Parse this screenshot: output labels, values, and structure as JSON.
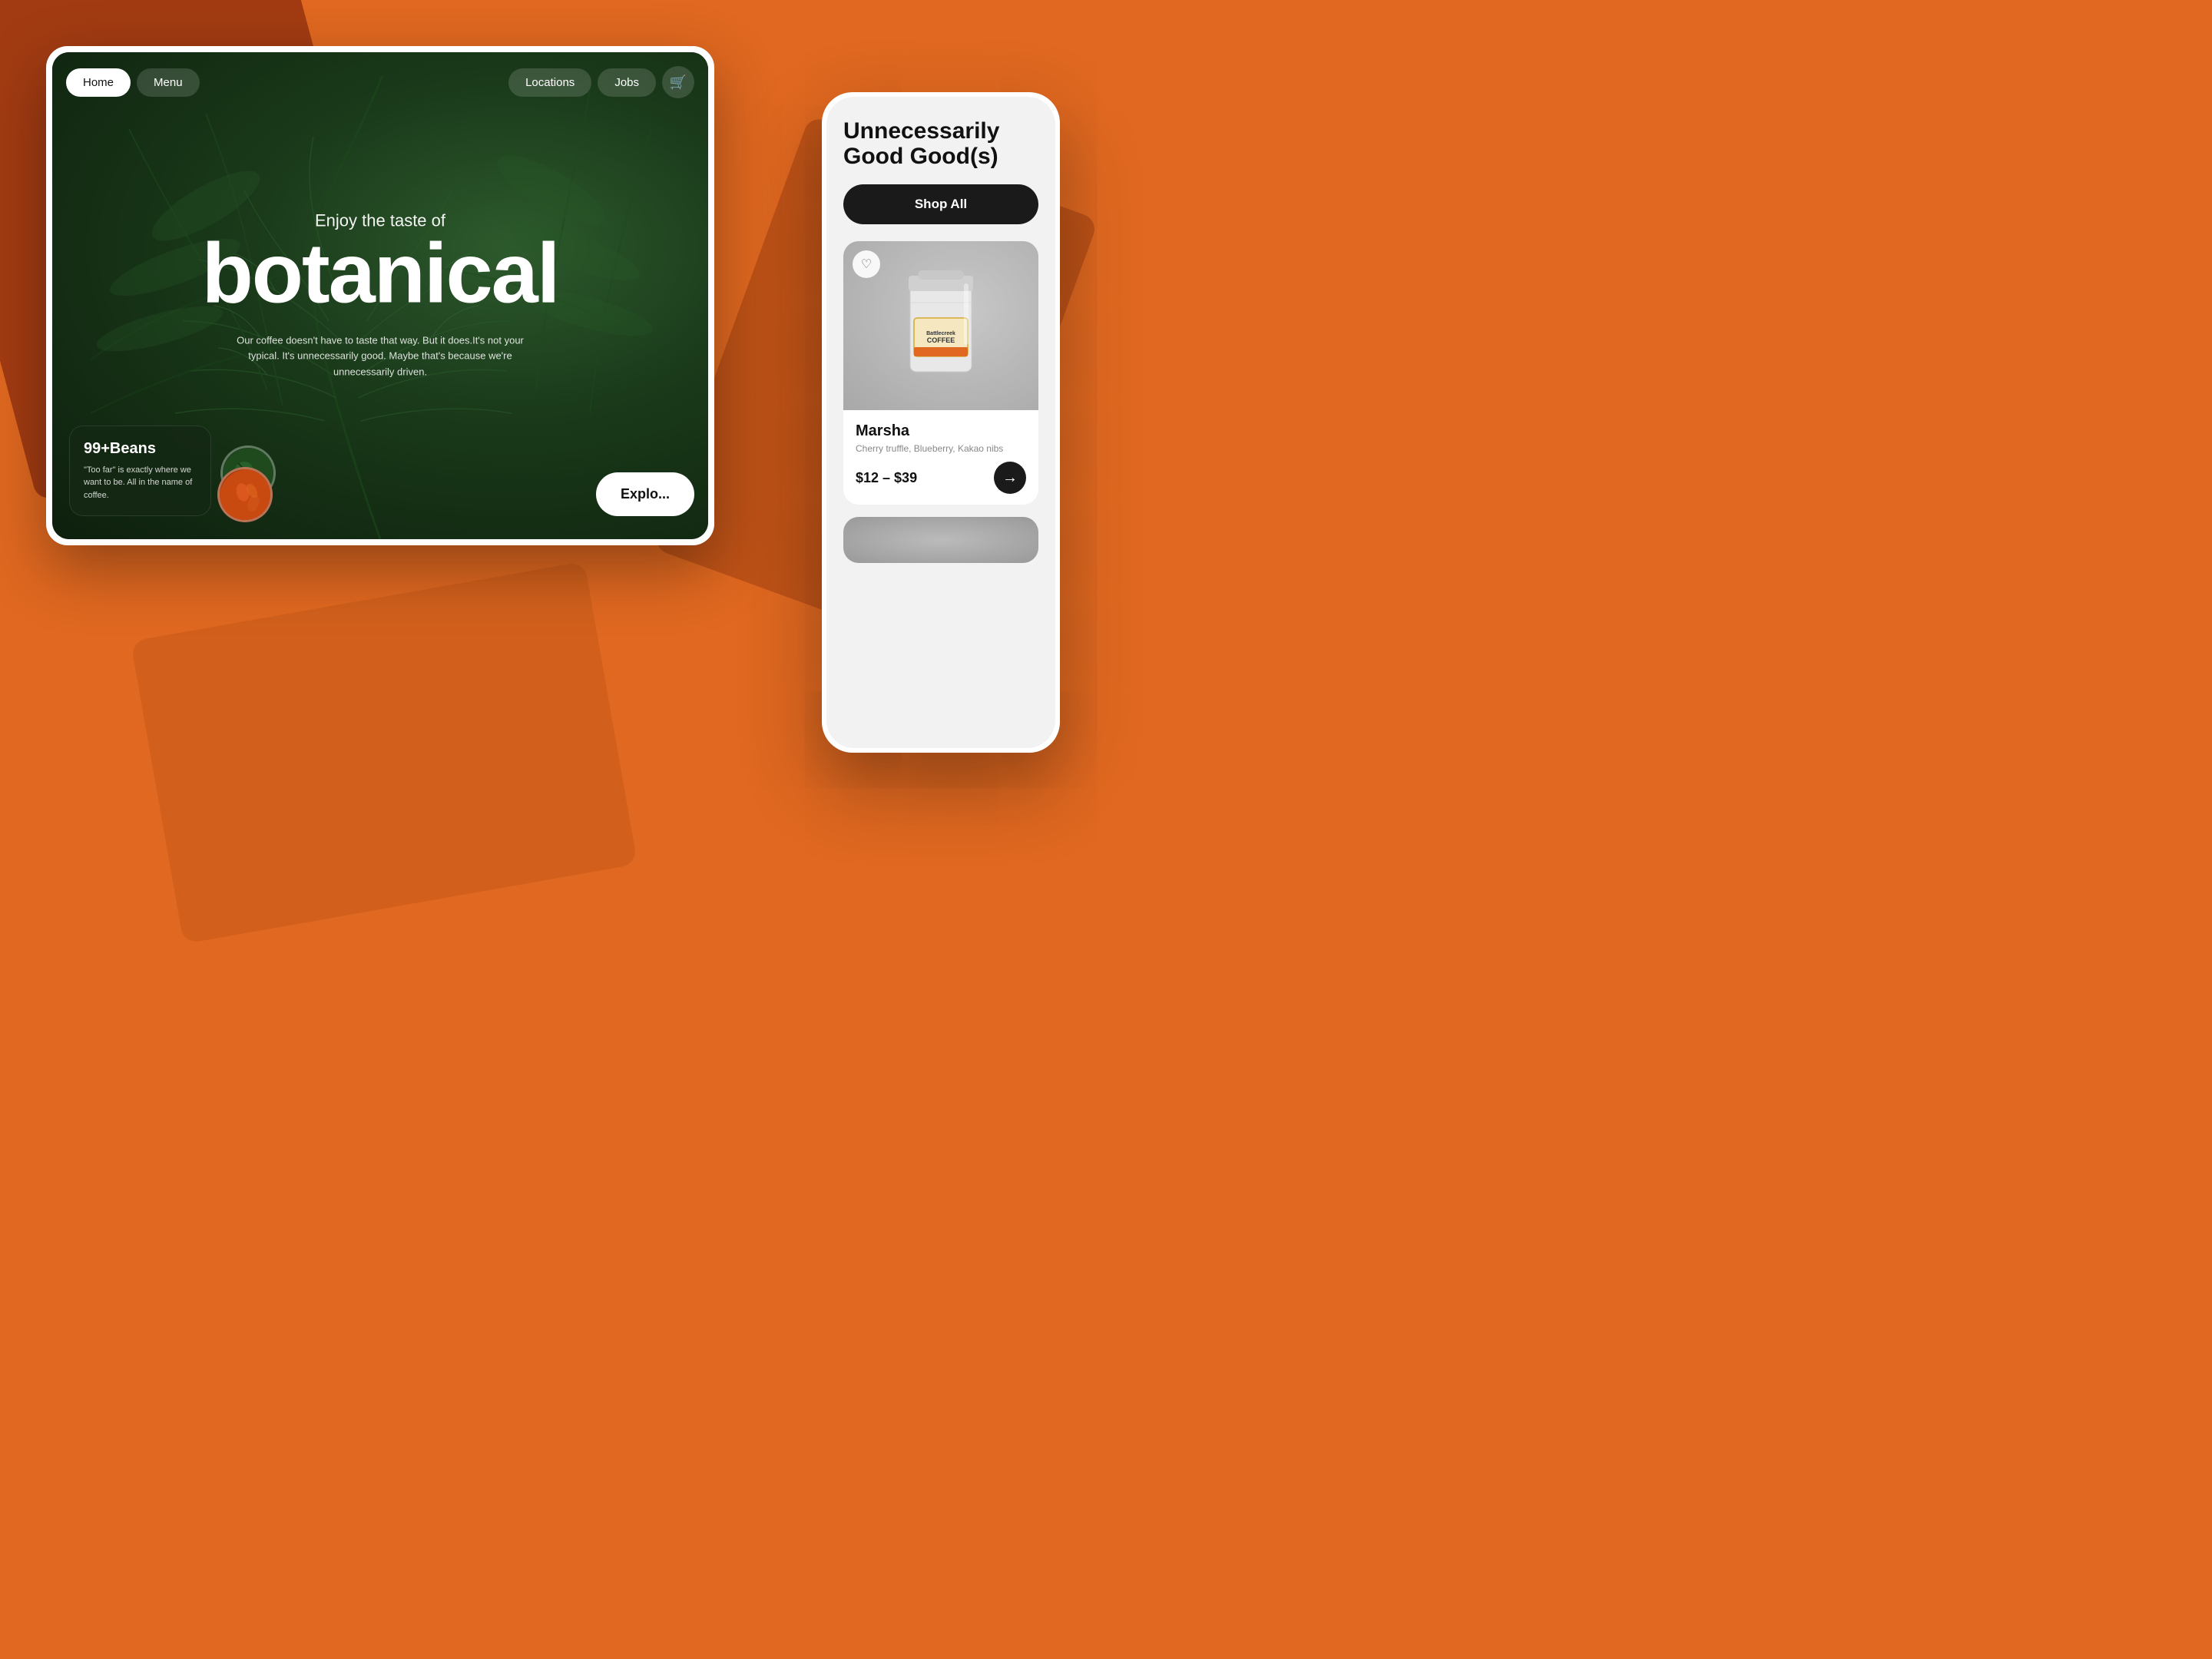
{
  "background": {
    "color": "#e06820"
  },
  "tablet": {
    "nav": {
      "home_label": "Home",
      "menu_label": "Menu",
      "locations_label": "Locations",
      "jobs_label": "Jobs",
      "cart_icon": "🛒"
    },
    "hero": {
      "subtitle": "Enjoy the taste of",
      "title": "botanical",
      "description": "Our coffee doesn't have to taste that way. But it does.It's not your typical. It's unnecessarily good. Maybe that's because we're unnecessarily driven."
    },
    "info_card": {
      "title": "99+Beans",
      "description": "\"Too far\" is exactly where we want to be. All in the name of coffee."
    },
    "explore_btn": "Explo..."
  },
  "mobile": {
    "title": "Unnecessarily\nGood Good(s)",
    "shop_all_label": "Shop All",
    "product": {
      "name": "Marsha",
      "description": "Cherry truffle, Blueberry, Kakao nibs",
      "price": "$12 – $39",
      "brand": "Battlecreek\nCOFFEE",
      "heart_icon": "♡",
      "add_icon": "→"
    }
  }
}
